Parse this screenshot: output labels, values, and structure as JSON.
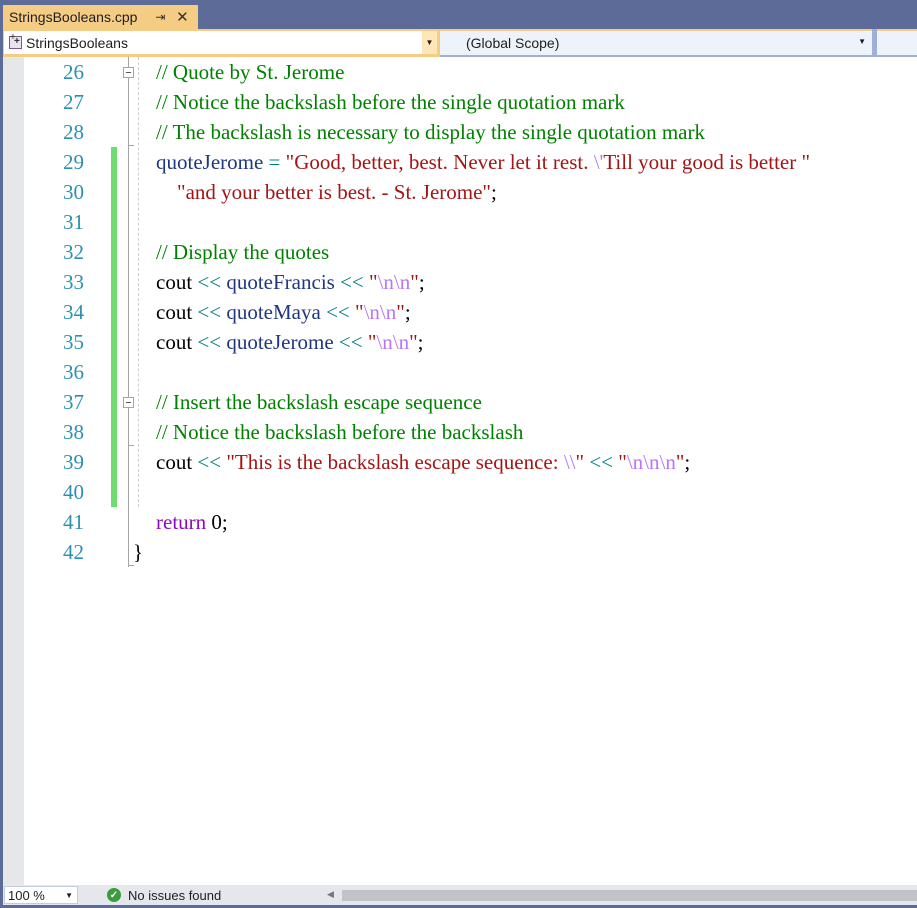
{
  "tab": {
    "title": "StringsBooleans.cpp",
    "pin_icon": "pin-icon",
    "close_icon": "close-icon",
    "active_color": "#f5cc84"
  },
  "navbar": {
    "project": "StringsBooleans",
    "scope": "(Global Scope)",
    "member": ""
  },
  "editor": {
    "lines": [
      {
        "num": "26",
        "tokens": [
          {
            "t": "// Quote by St. Jerome",
            "c": "comment"
          }
        ]
      },
      {
        "num": "27",
        "tokens": [
          {
            "t": "// Notice the backslash before the single quotation mark",
            "c": "comment"
          }
        ]
      },
      {
        "num": "28",
        "tokens": [
          {
            "t": "// The backslash is necessary to display the single quotation mark",
            "c": "comment"
          }
        ]
      },
      {
        "num": "29",
        "tokens": [
          {
            "t": "quoteJerome",
            "c": "var"
          },
          {
            "t": " = ",
            "c": "op"
          },
          {
            "t": "\"Good, better, best. Never let it rest. ",
            "c": "str"
          },
          {
            "t": "\\'",
            "c": "esc"
          },
          {
            "t": "Till your good is better \"",
            "c": "str"
          }
        ]
      },
      {
        "num": "30",
        "tokens": [
          {
            "t": "    ",
            "c": "plain"
          },
          {
            "t": "\"and your better is best. - St. Jerome\"",
            "c": "str"
          },
          {
            "t": ";",
            "c": "plain"
          }
        ]
      },
      {
        "num": "31",
        "tokens": []
      },
      {
        "num": "32",
        "tokens": [
          {
            "t": "// Display the quotes",
            "c": "comment"
          }
        ]
      },
      {
        "num": "33",
        "tokens": [
          {
            "t": "cout",
            "c": "plain"
          },
          {
            "t": " << ",
            "c": "op"
          },
          {
            "t": "quoteFrancis",
            "c": "var"
          },
          {
            "t": " << ",
            "c": "op"
          },
          {
            "t": "\"",
            "c": "str"
          },
          {
            "t": "\\n\\n",
            "c": "esc"
          },
          {
            "t": "\"",
            "c": "str"
          },
          {
            "t": ";",
            "c": "plain"
          }
        ]
      },
      {
        "num": "34",
        "tokens": [
          {
            "t": "cout",
            "c": "plain"
          },
          {
            "t": " << ",
            "c": "op"
          },
          {
            "t": "quoteMaya",
            "c": "var"
          },
          {
            "t": " << ",
            "c": "op"
          },
          {
            "t": "\"",
            "c": "str"
          },
          {
            "t": "\\n\\n",
            "c": "esc"
          },
          {
            "t": "\"",
            "c": "str"
          },
          {
            "t": ";",
            "c": "plain"
          }
        ]
      },
      {
        "num": "35",
        "tokens": [
          {
            "t": "cout",
            "c": "plain"
          },
          {
            "t": " << ",
            "c": "op"
          },
          {
            "t": "quoteJerome",
            "c": "var"
          },
          {
            "t": " << ",
            "c": "op"
          },
          {
            "t": "\"",
            "c": "str"
          },
          {
            "t": "\\n\\n",
            "c": "esc"
          },
          {
            "t": "\"",
            "c": "str"
          },
          {
            "t": ";",
            "c": "plain"
          }
        ]
      },
      {
        "num": "36",
        "tokens": []
      },
      {
        "num": "37",
        "tokens": [
          {
            "t": "// Insert the backslash escape sequence",
            "c": "comment"
          }
        ]
      },
      {
        "num": "38",
        "tokens": [
          {
            "t": "// Notice the backslash before the backslash",
            "c": "comment"
          }
        ]
      },
      {
        "num": "39",
        "tokens": [
          {
            "t": "cout",
            "c": "plain"
          },
          {
            "t": " << ",
            "c": "op"
          },
          {
            "t": "\"This is the backslash escape sequence: ",
            "c": "str"
          },
          {
            "t": "\\\\",
            "c": "esc"
          },
          {
            "t": "\"",
            "c": "str"
          },
          {
            "t": " << ",
            "c": "op"
          },
          {
            "t": "\"",
            "c": "str"
          },
          {
            "t": "\\n\\n\\n",
            "c": "esc"
          },
          {
            "t": "\"",
            "c": "str"
          },
          {
            "t": ";",
            "c": "plain"
          }
        ]
      },
      {
        "num": "40",
        "tokens": []
      },
      {
        "num": "41",
        "tokens": [
          {
            "t": "return",
            "c": "kw"
          },
          {
            "t": " 0;",
            "c": "plain"
          }
        ]
      },
      {
        "num": "42",
        "tokens": [
          {
            "t": "}",
            "c": "plain"
          }
        ],
        "outdent": true
      }
    ],
    "changed_lines": [
      "29",
      "30",
      "31",
      "32",
      "33",
      "34",
      "35",
      "36",
      "37",
      "38",
      "39",
      "40"
    ],
    "colors": {
      "comment": "#008000",
      "variable": "#1f377f",
      "operator": "#008080",
      "string": "#a31515",
      "escape": "#b776fb",
      "keyword": "#8f08c4",
      "line_number": "#2b91af",
      "change_bar": "#6fdc6f"
    }
  },
  "statusbar": {
    "zoom": "100 %",
    "issues": "No issues found",
    "issues_icon": "check-circle-icon"
  }
}
